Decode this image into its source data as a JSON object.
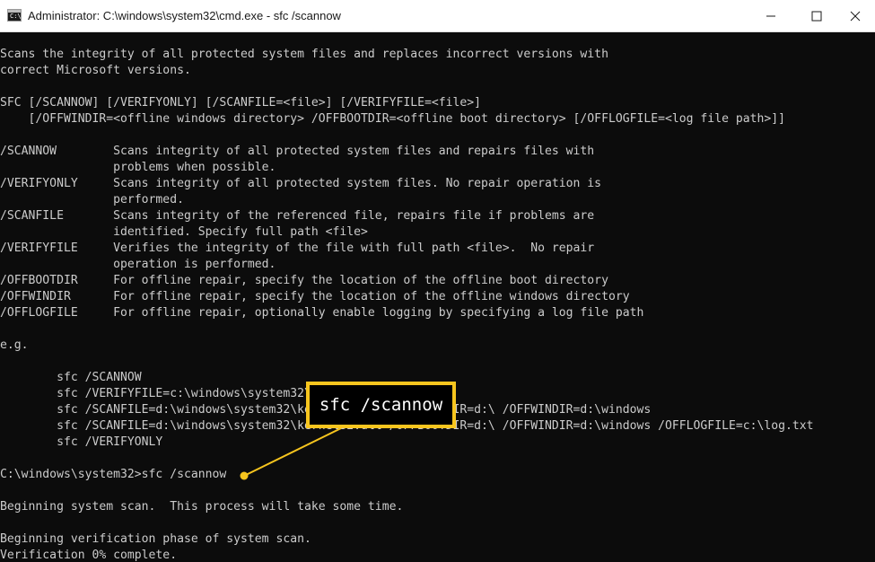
{
  "window": {
    "title": "Administrator: C:\\windows\\system32\\cmd.exe - sfc  /scannow",
    "icon": "cmd-icon",
    "controls": [
      "minimize-icon",
      "maximize-icon",
      "close-icon"
    ]
  },
  "console": {
    "lines": [
      "Scans the integrity of all protected system files and replaces incorrect versions with",
      "correct Microsoft versions.",
      "",
      "SFC [/SCANNOW] [/VERIFYONLY] [/SCANFILE=<file>] [/VERIFYFILE=<file>]",
      "    [/OFFWINDIR=<offline windows directory> /OFFBOOTDIR=<offline boot directory> [/OFFLOGFILE=<log file path>]]",
      "",
      "/SCANNOW        Scans integrity of all protected system files and repairs files with",
      "                problems when possible.",
      "/VERIFYONLY     Scans integrity of all protected system files. No repair operation is",
      "                performed.",
      "/SCANFILE       Scans integrity of the referenced file, repairs file if problems are",
      "                identified. Specify full path <file>",
      "/VERIFYFILE     Verifies the integrity of the file with full path <file>.  No repair",
      "                operation is performed.",
      "/OFFBOOTDIR     For offline repair, specify the location of the offline boot directory",
      "/OFFWINDIR      For offline repair, specify the location of the offline windows directory",
      "/OFFLOGFILE     For offline repair, optionally enable logging by specifying a log file path",
      "",
      "e.g.",
      "",
      "        sfc /SCANNOW",
      "        sfc /VERIFYFILE=c:\\windows\\system32\\kernel32.dll",
      "        sfc /SCANFILE=d:\\windows\\system32\\kernel32.dll /OFFBOOTDIR=d:\\ /OFFWINDIR=d:\\windows",
      "        sfc /SCANFILE=d:\\windows\\system32\\kernel32.dll /OFFBOOTDIR=d:\\ /OFFWINDIR=d:\\windows /OFFLOGFILE=c:\\log.txt",
      "        sfc /VERIFYONLY",
      "",
      "C:\\windows\\system32>sfc /scannow",
      "",
      "Beginning system scan.  This process will take some time.",
      "",
      "Beginning verification phase of system scan.",
      "Verification 0% complete."
    ]
  },
  "callout": {
    "text": "sfc /scannow",
    "color": "#f7c51e"
  },
  "colors": {
    "console_bg": "#0c0c0c",
    "console_fg": "#cccccc",
    "titlebar_bg": "#ffffff"
  }
}
